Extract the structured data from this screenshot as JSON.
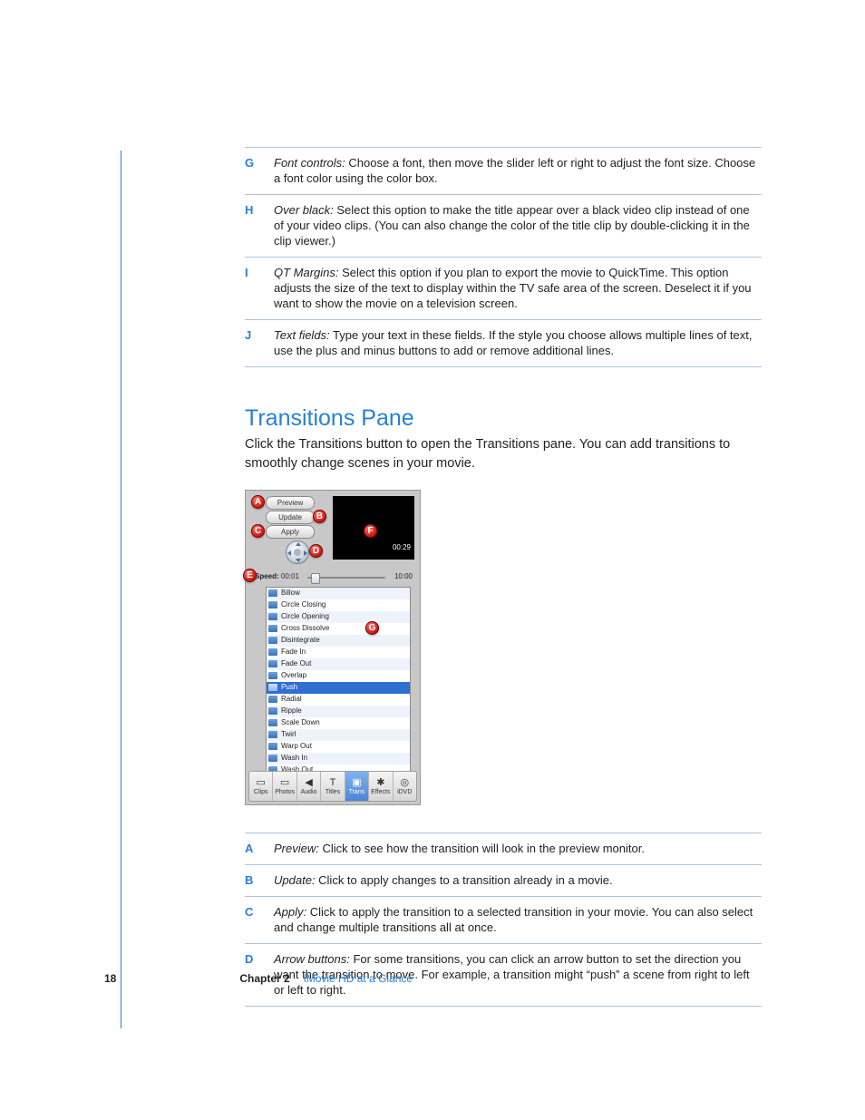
{
  "upper_callouts": [
    {
      "letter": "G",
      "lead": "Font controls:",
      "text": "  Choose a font, then move the slider left or right to adjust the font size. Choose a font color using the color box."
    },
    {
      "letter": "H",
      "lead": "Over black:",
      "text": "  Select this option to make the title appear over a black video clip instead of one of your video clips. (You can also change the color of the title clip by double-clicking it in the clip viewer.)"
    },
    {
      "letter": "I",
      "lead": "QT Margins:",
      "text": "  Select this option if you plan to export the movie to QuickTime. This option adjusts the size of the text to display within the TV safe area of the screen. Deselect it if you want to show the movie on a television screen."
    },
    {
      "letter": "J",
      "lead": "Text fields:",
      "text": "  Type your text in these fields. If the style you choose allows multiple lines of text, use the plus and minus buttons to add or remove additional lines."
    }
  ],
  "section": {
    "heading": "Transitions Pane",
    "body": "Click the Transitions button to open the Transitions pane. You can add transitions to smoothly change scenes in your movie."
  },
  "shot": {
    "buttons": {
      "preview": "Preview",
      "update": "Update",
      "apply": "Apply"
    },
    "preview_time": "00:29",
    "speed": {
      "label": "Speed:",
      "min": "00:01",
      "max": "10:00"
    },
    "transitions": [
      "Billow",
      "Circle Closing",
      "Circle Opening",
      "Cross Dissolve",
      "Disintegrate",
      "Fade In",
      "Fade Out",
      "Overlap",
      "Push",
      "Radial",
      "Ripple",
      "Scale Down",
      "Twirl",
      "Warp Out",
      "Wash In",
      "Wash Out"
    ],
    "selected_transition": "Push",
    "tabs": [
      "Clips",
      "Photos",
      "Audio",
      "Titles",
      "Trans",
      "Effects",
      "iDVD"
    ],
    "selected_tab": "Trans",
    "markers": [
      "A",
      "B",
      "C",
      "D",
      "E",
      "F",
      "G"
    ]
  },
  "lower_callouts": [
    {
      "letter": "A",
      "lead": "Preview:",
      "text": "  Click to see how the transition will look in the preview monitor."
    },
    {
      "letter": "B",
      "lead": "Update:",
      "text": "  Click to apply changes to a transition already in a movie."
    },
    {
      "letter": "C",
      "lead": "Apply:",
      "text": "  Click to apply the transition to a selected transition in your movie. You can also select and change multiple transitions all at once."
    },
    {
      "letter": "D",
      "lead": "Arrow buttons:",
      "text": "  For some transitions, you can click an arrow button to set the direction you want the transition to move. For example, a transition might “push” a scene from right to left or left to right."
    }
  ],
  "footer": {
    "page": "18",
    "chapter": "Chapter 2",
    "title": "iMovie HD at a Glance"
  }
}
